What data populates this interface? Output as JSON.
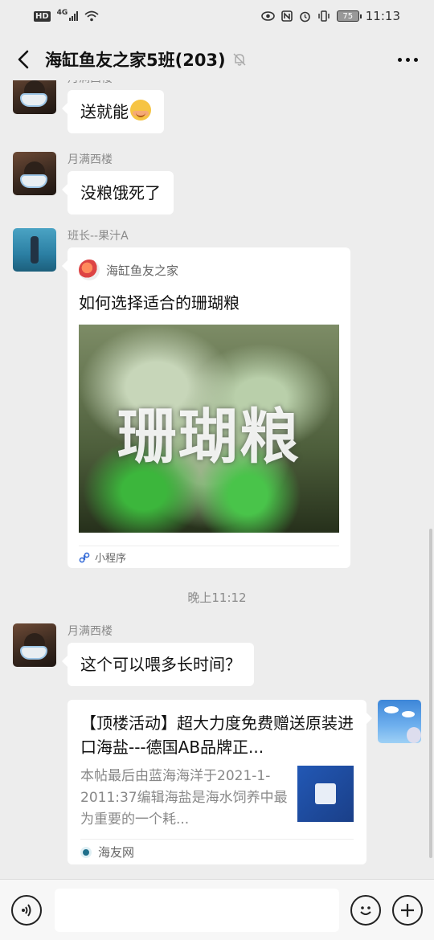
{
  "status_bar": {
    "network_badge": "HD",
    "network_type": "4G",
    "battery": "75",
    "time": "11:13"
  },
  "header": {
    "title": "海缸鱼友之家5班(203)"
  },
  "messages": [
    {
      "sender": "月满西楼",
      "text": "送就能"
    },
    {
      "sender": "月满西楼",
      "text": "没粮饿死了"
    },
    {
      "sender": "班长--果汁A",
      "mini_program": {
        "source": "海缸鱼友之家",
        "title": "如何选择适合的珊瑚粮",
        "image_text": "珊瑚粮",
        "footer": "小程序"
      }
    },
    {
      "sender": "月满西楼",
      "text": "这个可以喂多长时间？"
    }
  ],
  "timestamp": "晚上11:12",
  "link_card": {
    "title": "【顶楼活动】超大力度免费赠送原装进口海盐---德国AB品牌正...",
    "description": "本帖最后由蓝海海洋于2021-1-2011:37编辑海盐是海水饲养中最为重要的一个耗...",
    "site": "海友网"
  },
  "input": {
    "value": ""
  },
  "icons": [
    "back-icon",
    "mute-icon",
    "more-icon",
    "voice-icon",
    "emoji-icon",
    "add-icon"
  ]
}
